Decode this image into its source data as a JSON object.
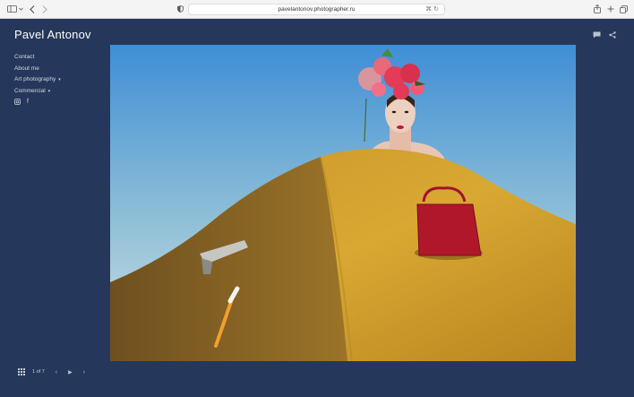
{
  "browser": {
    "url": "pavelantonov.photographer.ru",
    "icons": [
      "sidebar-icon",
      "back-icon",
      "forward-icon",
      "shield-icon",
      "translate-icon",
      "reload-icon",
      "share-icon",
      "new-tab-icon",
      "tabs-icon"
    ]
  },
  "site": {
    "title": "Pavel Antonov"
  },
  "nav": {
    "items": [
      {
        "label": "Contact",
        "has_dropdown": false
      },
      {
        "label": "About me",
        "has_dropdown": false
      },
      {
        "label": "Art photography",
        "has_dropdown": true
      },
      {
        "label": "Commercial",
        "has_dropdown": true
      }
    ],
    "caret": "▾"
  },
  "social": {
    "instagram": "◙",
    "facebook": "f"
  },
  "actions": {
    "comment_icon": "▮",
    "share_icon": "⋖"
  },
  "pager": {
    "counter": "1 of 7",
    "prev": "‹",
    "play": "▶",
    "next": "›"
  },
  "colors": {
    "background": "#25375a",
    "sky_top": "#3f8ed6",
    "sky_bottom": "#cfe1e6",
    "sand": "#d4a02c",
    "bag": "#b0172a"
  }
}
